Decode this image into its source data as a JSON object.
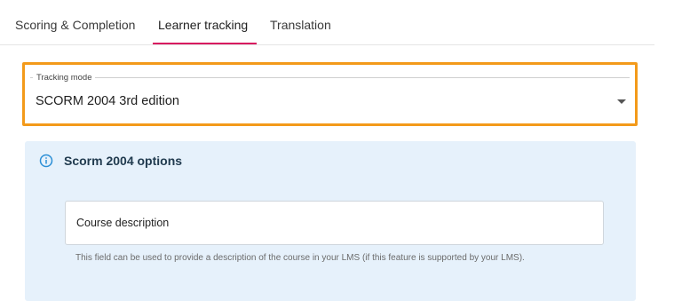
{
  "tabs": [
    {
      "label": "Scoring & Completion",
      "active": false
    },
    {
      "label": "Learner tracking",
      "active": true
    },
    {
      "label": "Translation",
      "active": false
    }
  ],
  "tracking": {
    "legend": "Tracking mode",
    "value": "SCORM 2004 3rd edition"
  },
  "options_panel": {
    "title": "Scorm 2004 options",
    "icon": "info-icon",
    "course_description": {
      "placeholder": "Course description",
      "value": "",
      "helper": "This field can be used to provide a description of the course in your LMS (if this feature is supported by your LMS)."
    }
  },
  "colors": {
    "tab_active_underline": "#d81b60",
    "highlight_border": "#f39a1a",
    "panel_background": "#e6f1fb",
    "info_icon": "#2b8fd6"
  }
}
